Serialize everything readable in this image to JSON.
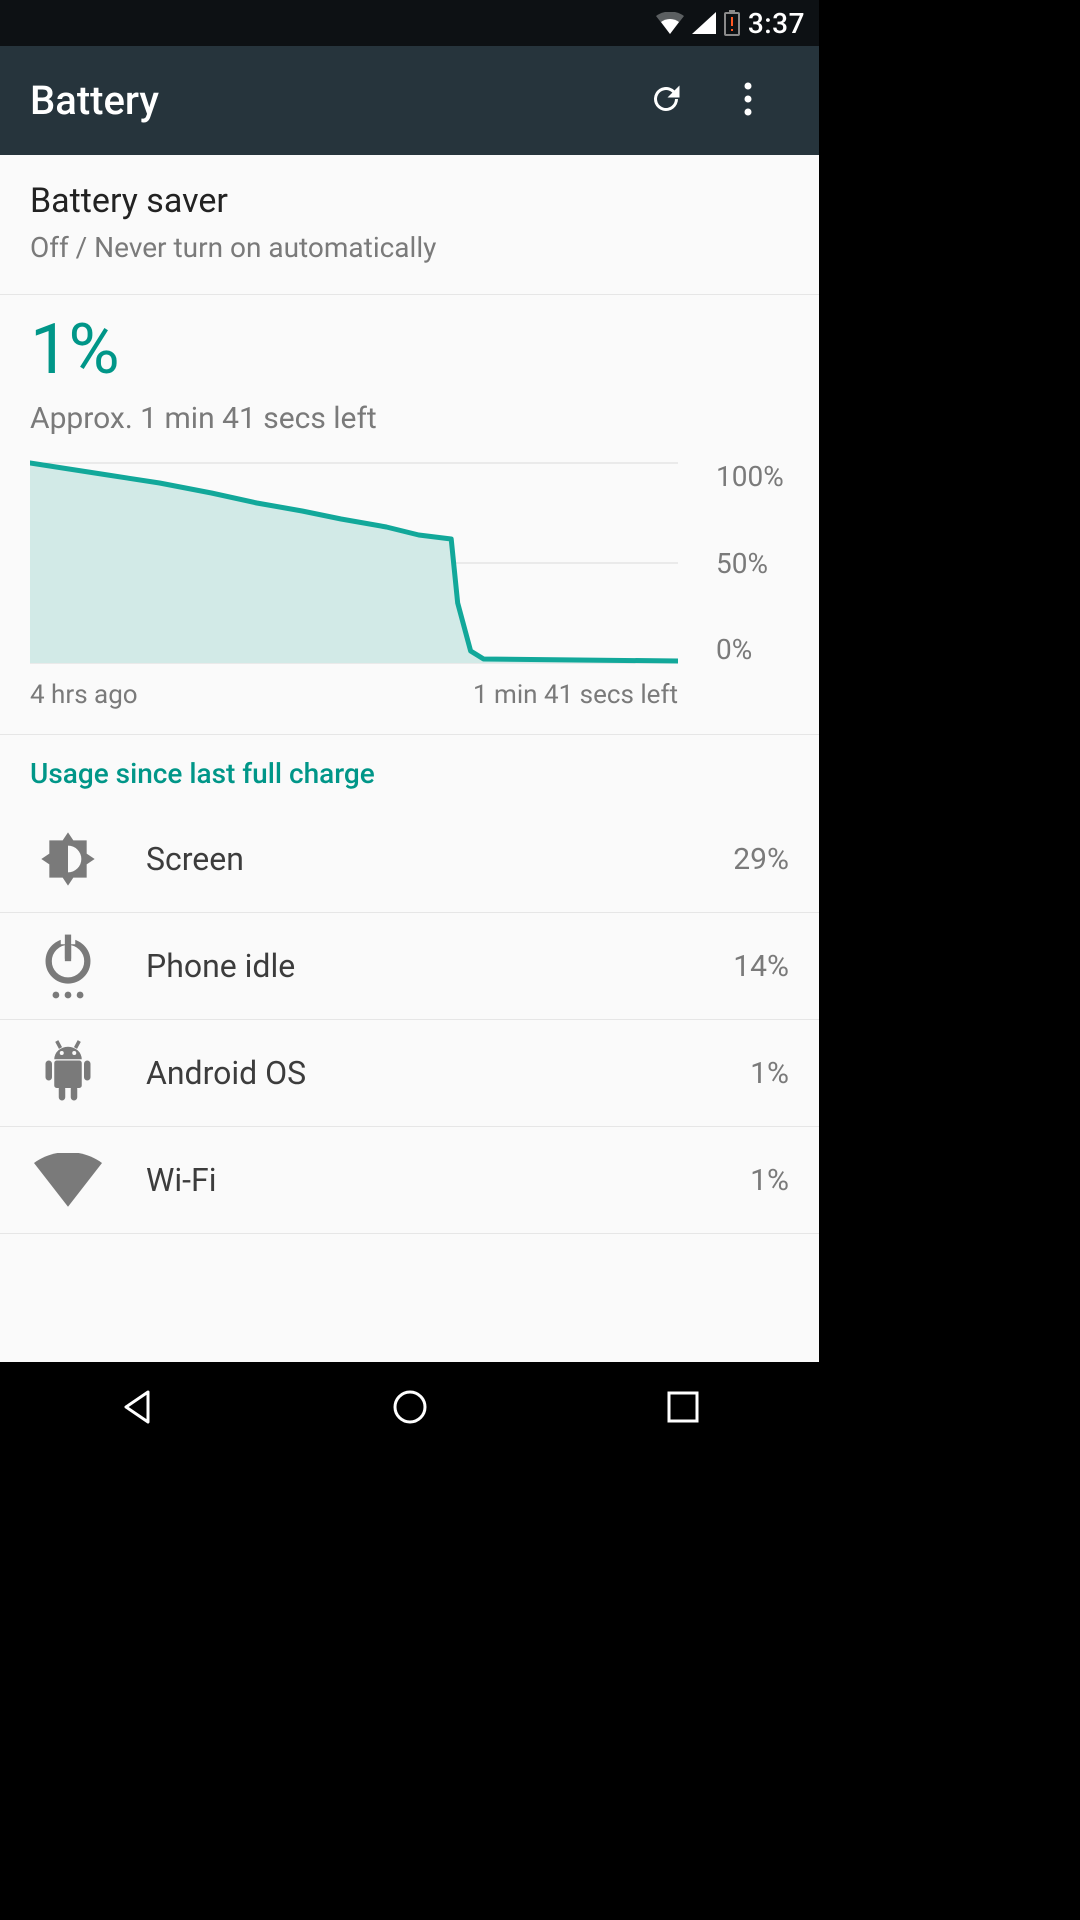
{
  "status": {
    "time": "3:37"
  },
  "appbar": {
    "title": "Battery"
  },
  "saver": {
    "title": "Battery saver",
    "subtitle": "Off / Never turn on automatically"
  },
  "battery": {
    "percent": "1%",
    "estimate": "Approx. 1 min 41 secs left"
  },
  "chart_data": {
    "type": "area",
    "xlabel_left": "4 hrs ago",
    "xlabel_right": "1 min 41 secs left",
    "ylabels": {
      "top": "100%",
      "mid": "50%",
      "bot": "0%"
    },
    "ylim": [
      0,
      100
    ],
    "x": [
      0,
      12,
      20,
      28,
      35,
      42,
      48,
      55,
      60,
      65,
      66,
      68,
      70,
      100
    ],
    "values": [
      100,
      94,
      90,
      85,
      80,
      76,
      72,
      68,
      64,
      62,
      30,
      6,
      2,
      1
    ]
  },
  "usage": {
    "header": "Usage since last full charge",
    "items": [
      {
        "icon": "brightness",
        "label": "Screen",
        "pct": "29%"
      },
      {
        "icon": "power-idle",
        "label": "Phone idle",
        "pct": "14%"
      },
      {
        "icon": "android",
        "label": "Android OS",
        "pct": "1%"
      },
      {
        "icon": "wifi",
        "label": "Wi-Fi",
        "pct": "1%"
      }
    ]
  },
  "colors": {
    "accent": "#009688",
    "chart_stroke": "#12a89a",
    "chart_fill": "#d2eae7",
    "icon_gray": "#7a7a7a"
  }
}
